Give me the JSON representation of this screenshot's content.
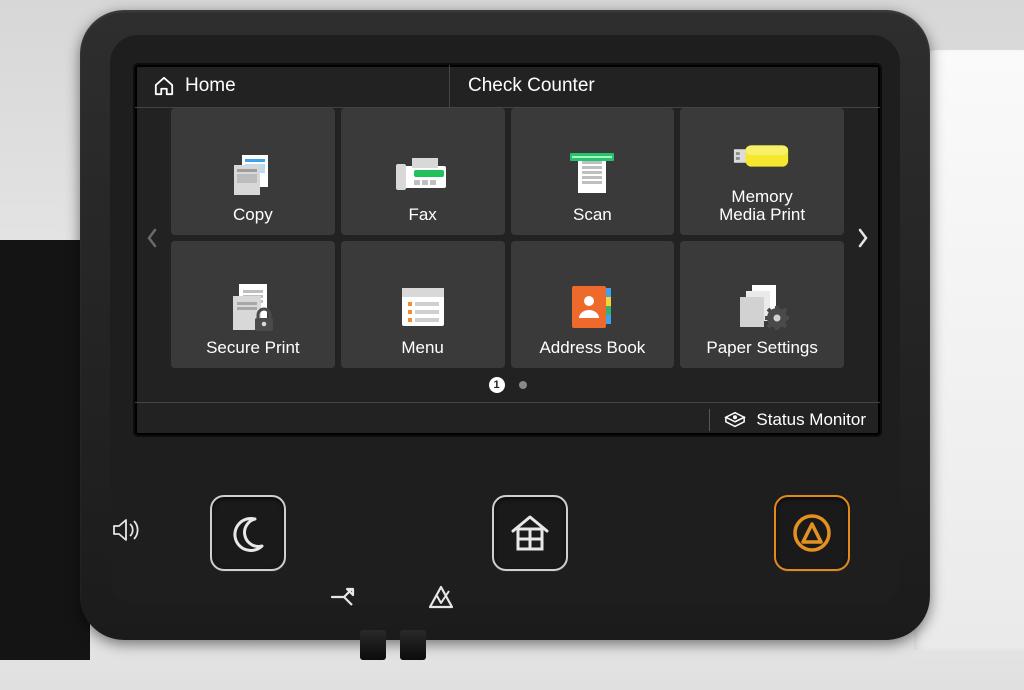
{
  "topbar": {
    "home_label": "Home",
    "counter_label": "Check Counter"
  },
  "tiles": [
    {
      "label": "Copy",
      "icon": "copy-icon"
    },
    {
      "label": "Fax",
      "icon": "fax-icon"
    },
    {
      "label": "Scan",
      "icon": "scan-icon"
    },
    {
      "label": "Memory\nMedia Print",
      "icon": "usb-icon"
    },
    {
      "label": "Secure Print",
      "icon": "secure-print-icon"
    },
    {
      "label": "Menu",
      "icon": "menu-icon"
    },
    {
      "label": "Address Book",
      "icon": "address-book-icon"
    },
    {
      "label": "Paper Settings",
      "icon": "paper-settings-icon"
    }
  ],
  "pagination": {
    "current": "1",
    "total": 2
  },
  "statusbar": {
    "monitor_label": "Status Monitor"
  },
  "hw_buttons": {
    "speaker": "speaker-icon",
    "sleep": "moon-icon",
    "home": "home-hw-icon",
    "stop": "stop-icon",
    "data": "data-indicator-icon",
    "error": "error-indicator-icon"
  }
}
